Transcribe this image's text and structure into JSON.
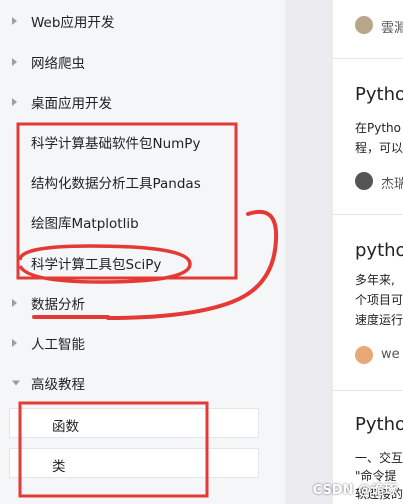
{
  "sidebar": {
    "items": [
      {
        "label": "Web应用开发"
      },
      {
        "label": "网络爬虫"
      },
      {
        "label": "桌面应用开发"
      },
      {
        "label": "科学计算基础软件包NumPy"
      },
      {
        "label": "结构化数据分析工具Pandas"
      },
      {
        "label": "绘图库Matplotlib"
      },
      {
        "label": "科学计算工具包SciPy"
      },
      {
        "label": "数据分析"
      },
      {
        "label": "人工智能"
      },
      {
        "label": "高级教程"
      }
    ],
    "subitems": [
      {
        "label": "函数"
      },
      {
        "label": "类"
      }
    ]
  },
  "articles": [
    {
      "author": "雲淵"
    },
    {
      "title": "Pytho",
      "lines": [
        "在Pytho",
        "程，可以"
      ],
      "author": "杰瑞"
    },
    {
      "title": "pytho",
      "lines": [
        "多年来,",
        "个项目可",
        "速度运行"
      ],
      "author": "we"
    },
    {
      "title": "Pytho",
      "lines": [
        "一、交互",
        "\"命令提",
        "软连接的"
      ]
    }
  ],
  "watermark": "CSDN @诡琢",
  "colors": {
    "annotation": "#e53935"
  }
}
